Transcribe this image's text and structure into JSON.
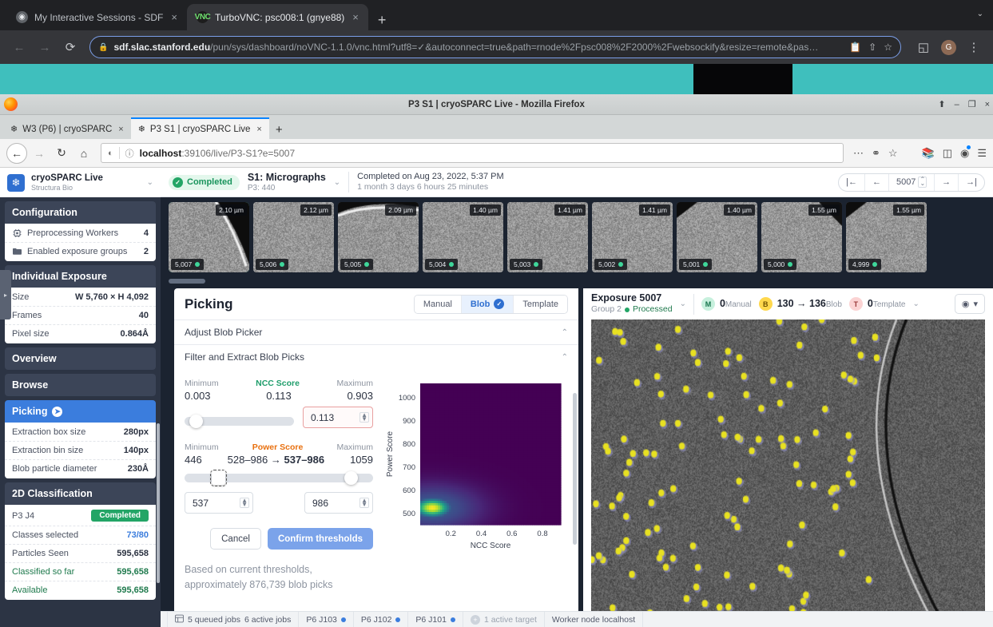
{
  "chrome": {
    "tabs": [
      {
        "title": "My Interactive Sessions - SDF",
        "icon": "globe-icon",
        "close": "×",
        "active": false
      },
      {
        "title": "TurboVNC: psc008:1 (gnye88)",
        "icon": "vnc-icon",
        "close": "×",
        "active": true
      }
    ],
    "new_tab": "+",
    "window_caret": "⌄",
    "back": "←",
    "forward": "→",
    "reload": "⟳",
    "lock_icon": "🔒",
    "url_domain": "sdf.slac.stanford.edu",
    "url_path": "/pun/sys/dashboard/noVNC-1.1.0/vnc.html?utf8=✓&autoconnect=true&path=rnode%2Fpsc008%2F2000%2Fwebsockify&resize=remote&pas…",
    "url_icons": [
      "clipboard-icon",
      "share-icon",
      "star-icon"
    ],
    "side_panel_icon": "◱",
    "profile_initial": "G",
    "menu_icon": "⋮"
  },
  "firefox": {
    "window_title": "P3 S1 | cryoSPARC Live - Mozilla Firefox",
    "window_controls": [
      "⬆",
      "–",
      "❐",
      "×"
    ],
    "tabs": [
      {
        "title": "W3 (P6) | cryoSPARC",
        "close": "×",
        "active": false
      },
      {
        "title": "P3 S1 | cryoSPARC Live",
        "close": "×",
        "active": true
      }
    ],
    "new_tab": "+",
    "back": "←",
    "forward": "→",
    "reload": "C",
    "home": "⌂",
    "shield_icon": "◑",
    "info_icon": "ⓘ",
    "url_host": "localhost",
    "url_rest": ":39106/live/P3-S1?e=5007",
    "toolbar_icons": [
      "library-icon",
      "sidebar-icon",
      "account-icon",
      "hamburger-icon"
    ]
  },
  "sidebar": {
    "brand_title": "cryoSPARC Live",
    "brand_sub": "Structura Bio",
    "brand_caret": "⌄",
    "sections": [
      {
        "title": "Configuration",
        "rows": [
          {
            "icon": "cpu-icon",
            "label": "Preprocessing Workers",
            "value": "4"
          },
          {
            "icon": "folder-icon",
            "label": "Enabled exposure groups",
            "value": "2"
          }
        ]
      },
      {
        "title": "Individual Exposure",
        "rows": [
          {
            "label": "Size",
            "value": "W 5,760 × H 4,092"
          },
          {
            "label": "Frames",
            "value": "40"
          },
          {
            "label": "Pixel size",
            "value": "0.864Å"
          }
        ]
      },
      {
        "title": "Overview",
        "rows": []
      },
      {
        "title": "Browse",
        "rows": []
      },
      {
        "title": "Picking",
        "selected": true,
        "arrow": "➔",
        "rows": [
          {
            "label": "Extraction box size",
            "value": "280px"
          },
          {
            "label": "Extraction bin size",
            "value": "140px"
          },
          {
            "label": "Blob particle diameter",
            "value": "230Å"
          }
        ]
      },
      {
        "title": "2D Classification",
        "rows": [
          {
            "label": "P3 J4",
            "badge": "Completed"
          },
          {
            "label": "Classes selected",
            "value": "73/80",
            "value_style": "blue"
          },
          {
            "label": "Particles Seen",
            "value": "595,658"
          },
          {
            "label": "Classified so far",
            "value": "595,658",
            "label_style": "green"
          },
          {
            "label": "Available",
            "value": "595,658",
            "label_style": "green"
          }
        ]
      }
    ]
  },
  "topbar": {
    "status_badge": "Completed",
    "session_title": "S1: Micrographs",
    "session_sub": "P3: 440",
    "caret": "⌄",
    "completed_on": "Completed on Aug 23, 2022, 5:37 PM",
    "duration": "1 month 3 days 6 hours 25 minutes",
    "nav": {
      "first": "|←",
      "prev": "←",
      "value": "5007",
      "next": "→",
      "last": "→|",
      "spin_up": "⌃",
      "spin_down": "⌄"
    }
  },
  "filmstrip": [
    {
      "id": "5,007",
      "defocus": "2.10 µm",
      "selected": true
    },
    {
      "id": "5,006",
      "defocus": "2.12 µm",
      "selected": false
    },
    {
      "id": "5,005",
      "defocus": "2.09 µm",
      "selected": false
    },
    {
      "id": "5,004",
      "defocus": "1.40 µm",
      "selected": false
    },
    {
      "id": "5,003",
      "defocus": "1.41 µm",
      "selected": false
    },
    {
      "id": "5,002",
      "defocus": "1.41 µm",
      "selected": false
    },
    {
      "id": "5,001",
      "defocus": "1.40 µm",
      "selected": false
    },
    {
      "id": "5,000",
      "defocus": "1.55 µm",
      "selected": false
    },
    {
      "id": "4,999",
      "defocus": "1.55 µm",
      "selected": false
    }
  ],
  "picking": {
    "title": "Picking",
    "modes": [
      {
        "label": "Manual",
        "active": false
      },
      {
        "label": "Blob",
        "active": true,
        "check": "✓"
      },
      {
        "label": "Template",
        "active": false
      }
    ],
    "accordions": [
      {
        "label": "Adjust Blob Picker",
        "caret": "⌃"
      },
      {
        "label": "Filter and Extract Blob Picks",
        "caret": "⌃"
      }
    ],
    "ncc": {
      "min_label": "Minimum",
      "title": "NCC Score",
      "max_label": "Maximum",
      "min_value": "0.003",
      "current": "0.113",
      "max_value": "0.903",
      "input_value": "0.113"
    },
    "power": {
      "min_label": "Minimum",
      "title": "Power Score",
      "max_label": "Maximum",
      "min_value": "446",
      "old_range": "528–986",
      "arrow": "→",
      "new_range": "537–986",
      "max_value": "1059",
      "low_input": "537",
      "high_input": "986"
    },
    "cancel_label": "Cancel",
    "confirm_label": "Confirm thresholds",
    "note_line1": "Based on current thresholds,",
    "note_line2": "approximately 876,739 blob picks"
  },
  "chart_data": {
    "type": "heatmap",
    "title": "",
    "xlabel": "NCC Score",
    "ylabel": "Power Score",
    "xticks": [
      "0.2",
      "0.4",
      "0.6",
      "0.8"
    ],
    "yticks": [
      "500",
      "600",
      "700",
      "800",
      "900",
      "1000"
    ],
    "xlim": [
      0.0,
      0.92
    ],
    "ylim": [
      450,
      1060
    ],
    "colormap": "viridis",
    "background_color": "#2a0a4a",
    "hotspot": {
      "x": 0.08,
      "y": 525,
      "peak_color": "#f6e726",
      "intensity": 1.0
    },
    "grid": false,
    "legend": "none"
  },
  "exposure": {
    "title": "Exposure 5007",
    "group": "Group 2",
    "processed": "Processed",
    "caret": "⌄",
    "counts": [
      {
        "key": "M",
        "value": "0",
        "label": "Manual"
      },
      {
        "key": "B",
        "value": "130 → 136",
        "label": "Blob"
      },
      {
        "key": "T",
        "value": "0",
        "label": "Template"
      }
    ],
    "more_caret": "⌄",
    "eye_icon": "◉",
    "eye_caret": "▾"
  },
  "statusbar": {
    "jobs_icon": "queue-icon",
    "queued_jobs": "5 queued jobs",
    "active_jobs": "6 active jobs",
    "job_chips": [
      "P6 J103",
      "P6 J102",
      "P6 J101"
    ],
    "plus": "+",
    "active_target": "1 active target",
    "worker": "Worker node localhost"
  }
}
